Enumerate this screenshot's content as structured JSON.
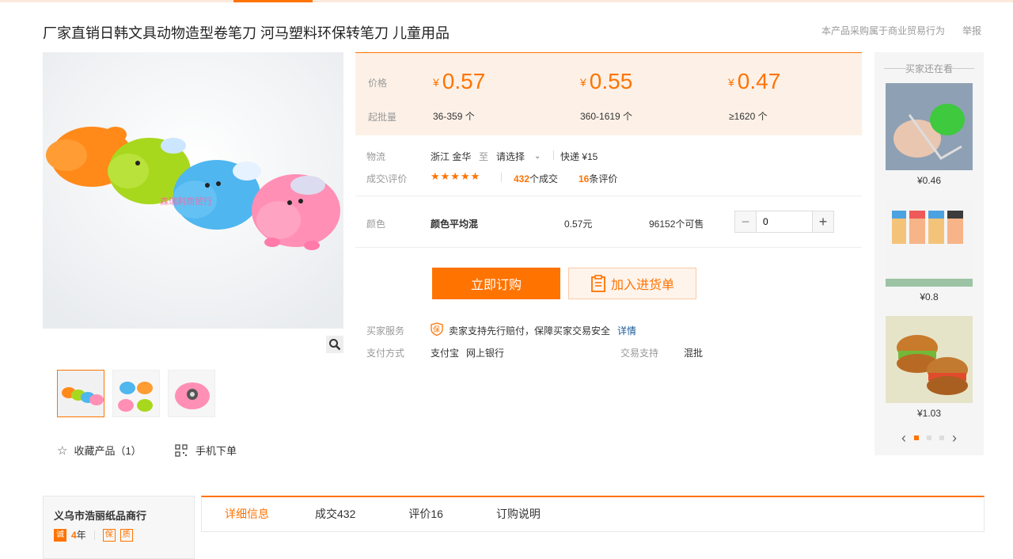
{
  "product": {
    "title": "厂家直销日韩文具动物造型卷笔刀 河马塑料环保转笔刀 儿童用品"
  },
  "top_links": {
    "notice": "本产品采购属于商业贸易行为",
    "report": "举报"
  },
  "gallery": {
    "watermark": "森瑞利商贸行",
    "favorite_label": "收藏产品（1）",
    "mobile_order_label": "手机下单"
  },
  "pricing": {
    "price_label": "价格",
    "moq_label": "起批量",
    "currency": "¥",
    "tiers": [
      {
        "price": "0.57",
        "qty": "36-359 个"
      },
      {
        "price": "0.55",
        "qty": "360-1619 个"
      },
      {
        "price": "0.47",
        "qty": "≥1620 个"
      }
    ]
  },
  "logistics": {
    "label": "物流",
    "from": "浙江 金华",
    "to_word": "至",
    "destination": "请选择",
    "express": "快递 ¥15"
  },
  "reviews": {
    "label": "成交\\评价",
    "stars": "★★★★★",
    "deals_count": "432",
    "deals_suffix": "个成交",
    "review_count": "16",
    "review_suffix": "条评价"
  },
  "variant": {
    "label": "颜色",
    "name": "颜色平均混",
    "price": "0.57元",
    "stock": "96152个可售",
    "quantity": "0",
    "minus": "−",
    "plus": "+"
  },
  "actions": {
    "buy_now": "立即订购",
    "add_to_cart": "加入进货单"
  },
  "services": {
    "buyer_label": "买家服务",
    "guarantee_badge": "保",
    "guarantee_text": "卖家支持先行赔付，保障买家交易安全",
    "details_link": "详情",
    "payment_label": "支付方式",
    "payment_methods": [
      "支付宝",
      "网上银行"
    ],
    "trade_label": "交易支持",
    "trade_value": "混批"
  },
  "sidebar": {
    "title": "买家还在看",
    "items": [
      {
        "price": "¥0.46"
      },
      {
        "price": "¥0.8"
      },
      {
        "price": "¥1.03"
      }
    ]
  },
  "shop": {
    "name": "义乌市浩丽纸品商行",
    "years_badge": "诚",
    "years_value": "4",
    "years_unit": "年",
    "badge_1": "保",
    "badge_2": "质"
  },
  "tabs": [
    {
      "label": "详细信息"
    },
    {
      "label": "成交432"
    },
    {
      "label": "评价16"
    },
    {
      "label": "订购说明"
    }
  ],
  "colors": {
    "accent": "#ff7300",
    "price_bg": "#fdf1e7"
  }
}
